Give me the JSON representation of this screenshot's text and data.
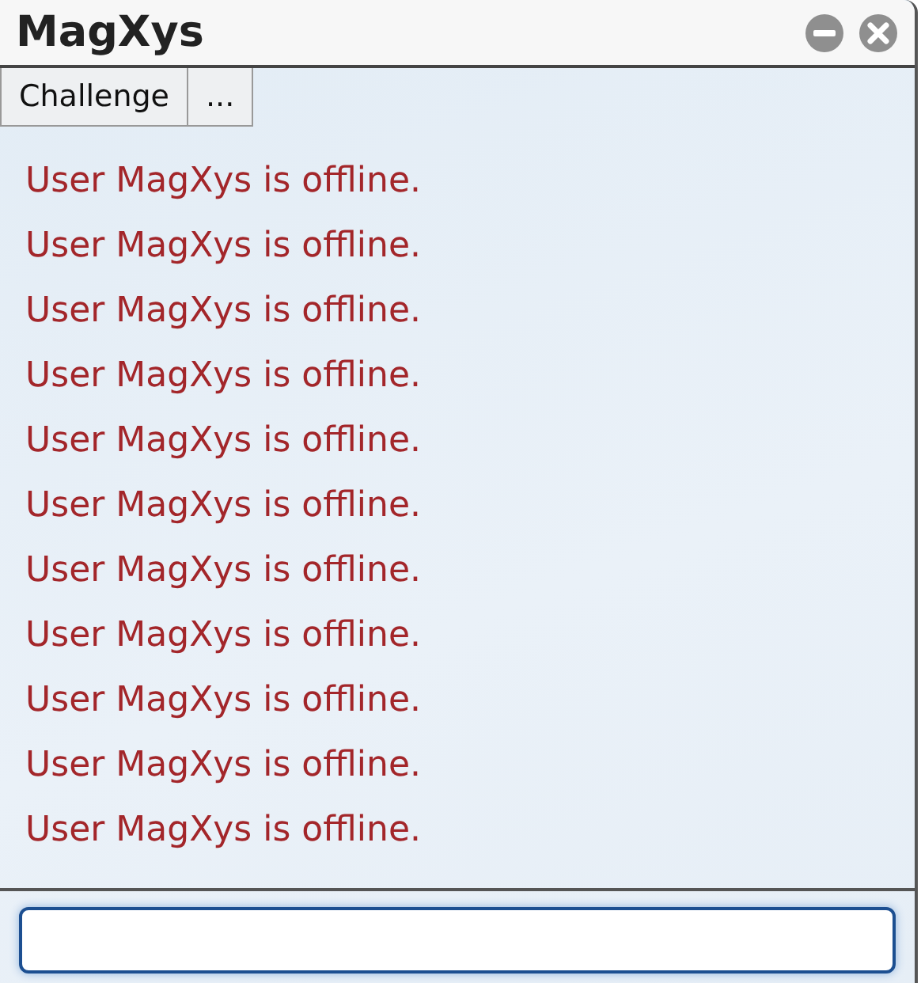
{
  "window": {
    "title": "MagXys"
  },
  "toolbar": [
    "Challenge",
    "..."
  ],
  "messages": [
    "User MagXys is offline.",
    "User MagXys is offline.",
    "User MagXys is offline.",
    "User MagXys is offline.",
    "User MagXys is offline.",
    "User MagXys is offline.",
    "User MagXys is offline.",
    "User MagXys is offline.",
    "User MagXys is offline.",
    "User MagXys is offline.",
    "User MagXys is offline."
  ]
}
